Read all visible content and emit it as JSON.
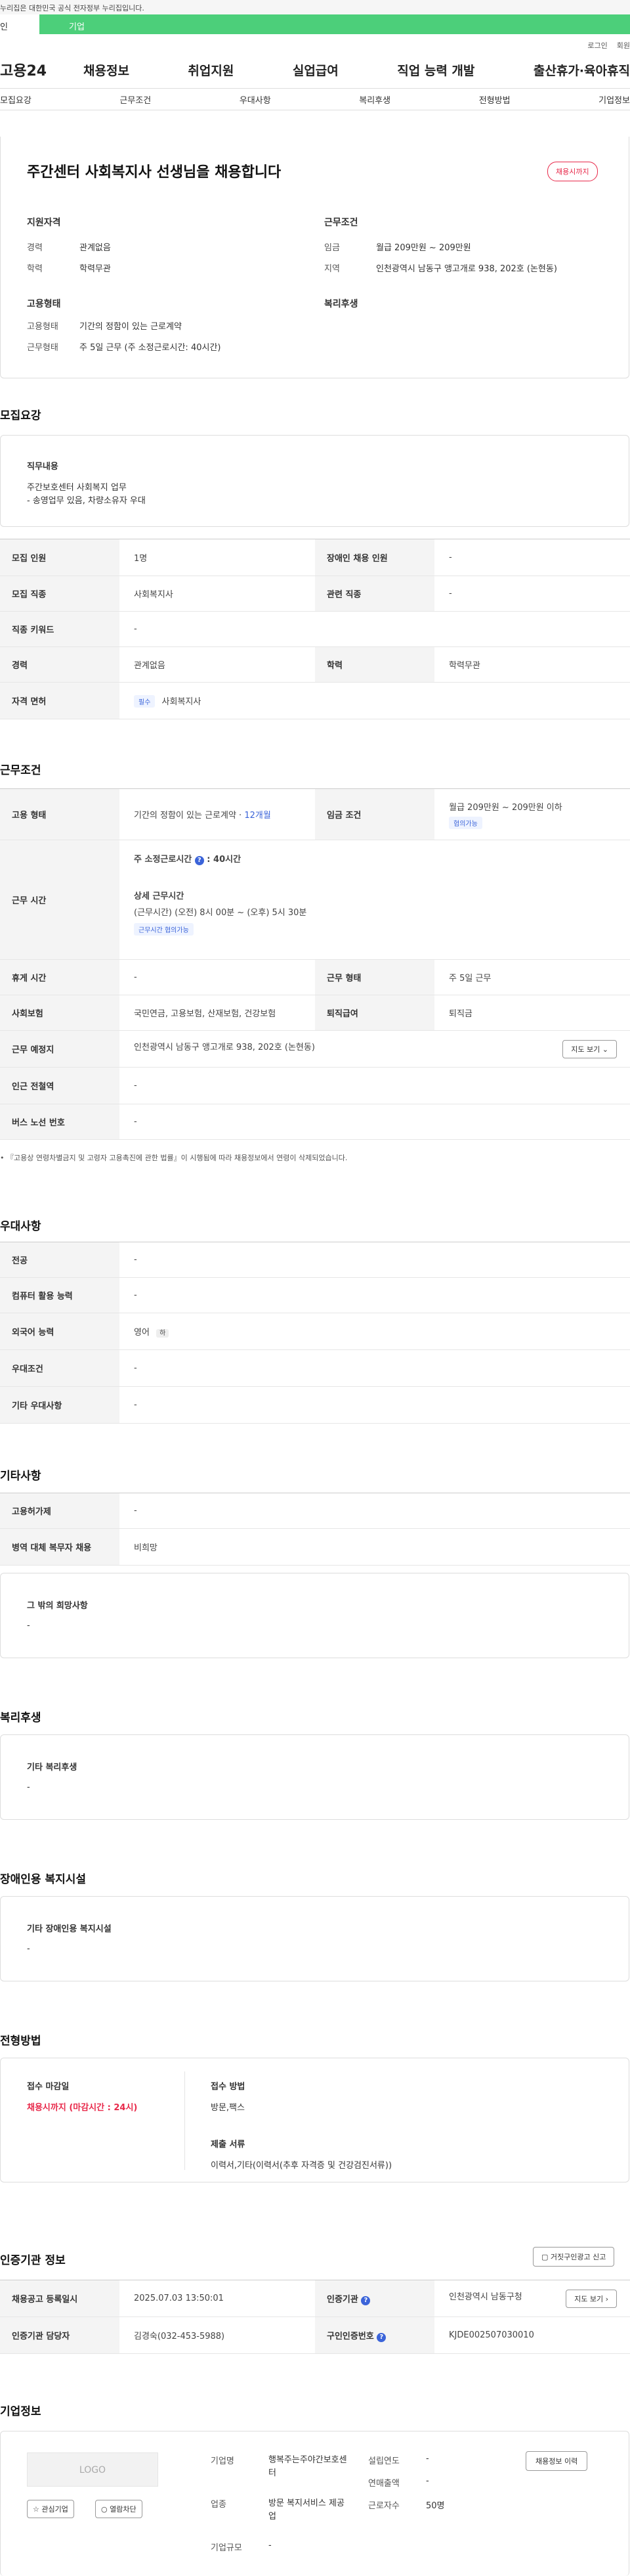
{
  "top_notice": "누리집은 대한민국 공식 전자정부 누리집입니다.",
  "user_tabs": [
    "인",
    "기업"
  ],
  "util": [
    "로그인",
    "회원"
  ],
  "logo": "고용24",
  "gnb": [
    "채용정보",
    "취업지원",
    "실업급여",
    "직업 능력 개발",
    "출산휴가·육아휴직"
  ],
  "anchors": [
    "모집요강",
    "근무조건",
    "우대사항",
    "복리후생",
    "전형방법",
    "기업정보"
  ],
  "headline": "주간센터 사회복지사 선생님을 채용합니다",
  "deadline_badge": "채용시까지",
  "summary": {
    "qual_title": "지원자격",
    "exp_l": "경력",
    "exp_v": "관계없음",
    "edu_l": "학력",
    "edu_v": "학력무관",
    "cond_title": "근무조건",
    "wage_l": "임금",
    "wage_v": "월급 209만원 ~ 209만원",
    "loc_l": "지역",
    "loc_v": "인천광역시 남동구 앵고개로 938, 202호 (논현동)",
    "emp_title": "고용형태",
    "type_l": "고용형태",
    "type_v": "기간의 정함이 있는 근로계약",
    "work_l": "근무형태",
    "work_v": "주 5일 근무 (주 소정근로시간: 40시간)",
    "welfare_title": "복리후생"
  },
  "recruit": {
    "title": "모집요강",
    "duty_l": "직무내용",
    "duty_1": "주간보호센터 사회복지 업무",
    "duty_2": "- 송영업무 있음, 차량소유자 우대",
    "r1": [
      "모집 인원",
      "1명",
      "장애인 채용 인원",
      "-"
    ],
    "r2": [
      "모집 직종",
      "사회복지사",
      "관련 직종",
      "-"
    ],
    "r3": [
      "직종 키워드",
      "-"
    ],
    "r4": [
      "경력",
      "관계없음",
      "학력",
      "학력무관"
    ],
    "r5": [
      "자격 면허",
      "필수",
      "사회복지사"
    ]
  },
  "cond": {
    "title": "근무조건",
    "r1": [
      "고용 형태",
      "기간의 정함이 있는 근로계약 · ",
      "12개월",
      "임금 조건",
      "월급 209만원 ~ 209만원 이하",
      "협의가능"
    ],
    "r2": [
      "근무 시간",
      "주 소정근로시간",
      "40시간",
      "상세 근무시간",
      "(근무시간) (오전) 8시 00분 ~ (오후) 5시 30분",
      "근무시간 협의가능"
    ],
    "r3": [
      "휴게 시간",
      "-",
      "근무 형태",
      "주 5일 근무"
    ],
    "r4": [
      "사회보험",
      "국민연금, 고용보험, 산재보험, 건강보험",
      "퇴직급여",
      "퇴직금"
    ],
    "r5": [
      "근무 예정지",
      "인천광역시 남동구 앵고개로 938, 202호 (논현동)",
      "지도 보기"
    ],
    "r6": [
      "인근 전철역",
      "-"
    ],
    "r7": [
      "버스 노선 번호",
      "-"
    ],
    "note": "『고용상 연령차별금지 및 고령자 고용촉진에 관한 법률』이 시행됨에 따라 채용정보에서 연령이 삭제되었습니다."
  },
  "pref": {
    "title": "우대사항",
    "rows": [
      [
        "전공",
        "-"
      ],
      [
        "컴퓨터 활용 능력",
        "-"
      ],
      [
        "외국어 능력",
        "영어",
        "하"
      ],
      [
        "우대조건",
        "-"
      ],
      [
        "기타 우대사항",
        "-"
      ]
    ]
  },
  "etc": {
    "title": "기타사항",
    "rows": [
      [
        "고용허가제",
        "-"
      ],
      [
        "병역 대체 복무자 채용",
        "비희망"
      ]
    ],
    "hope_l": "그 밖의 희망사항",
    "hope_v": "-"
  },
  "welfare": {
    "title": "복리후생",
    "l": "기타 복리후생",
    "v": "-"
  },
  "disab": {
    "title": "장애인용 복지시설",
    "l": "기타 장애인용 복지시설",
    "v": "-"
  },
  "select": {
    "title": "전형방법",
    "dl": "접수 마감일",
    "dv": "채용시까지 (마감시간 : 24시)",
    "ml": "접수 방법",
    "mv": "방문,팩스",
    "fl": "제출 서류",
    "fv": "이력서,기타(이력서(추후 자격증 및 건강검진서류))"
  },
  "agency": {
    "title": "인증기관 정보",
    "report": "거짓구인광고 신고",
    "r1": [
      "채용공고 등록일시",
      "2025.07.03 13:50:01",
      "인증기관",
      "인천광역시 남동구청",
      "지도 보기"
    ],
    "r2": [
      "인증기관 담당자",
      "김경숙(032-453-5988)",
      "구인인증번호",
      "KJDE002507030010"
    ]
  },
  "company": {
    "title": "기업정보",
    "logo": "LOGO",
    "fav": "관심기업",
    "block": "열람차단",
    "name_l": "기업명",
    "name_v": "행복주는주야간보호센터",
    "ind_l": "업종",
    "ind_v": "방문 복지서비스 제공업",
    "size_l": "기업규모",
    "size_v": "-",
    "year_l": "설립연도",
    "year_v": "-",
    "sales_l": "연매출액",
    "sales_v": "-",
    "emp_l": "근로자수",
    "emp_v": "50명",
    "btn": "채용정보 이력"
  },
  "colors": {
    "green": "#4ccf7a",
    "blue": "#3b64d9",
    "red": "#e8294a"
  }
}
